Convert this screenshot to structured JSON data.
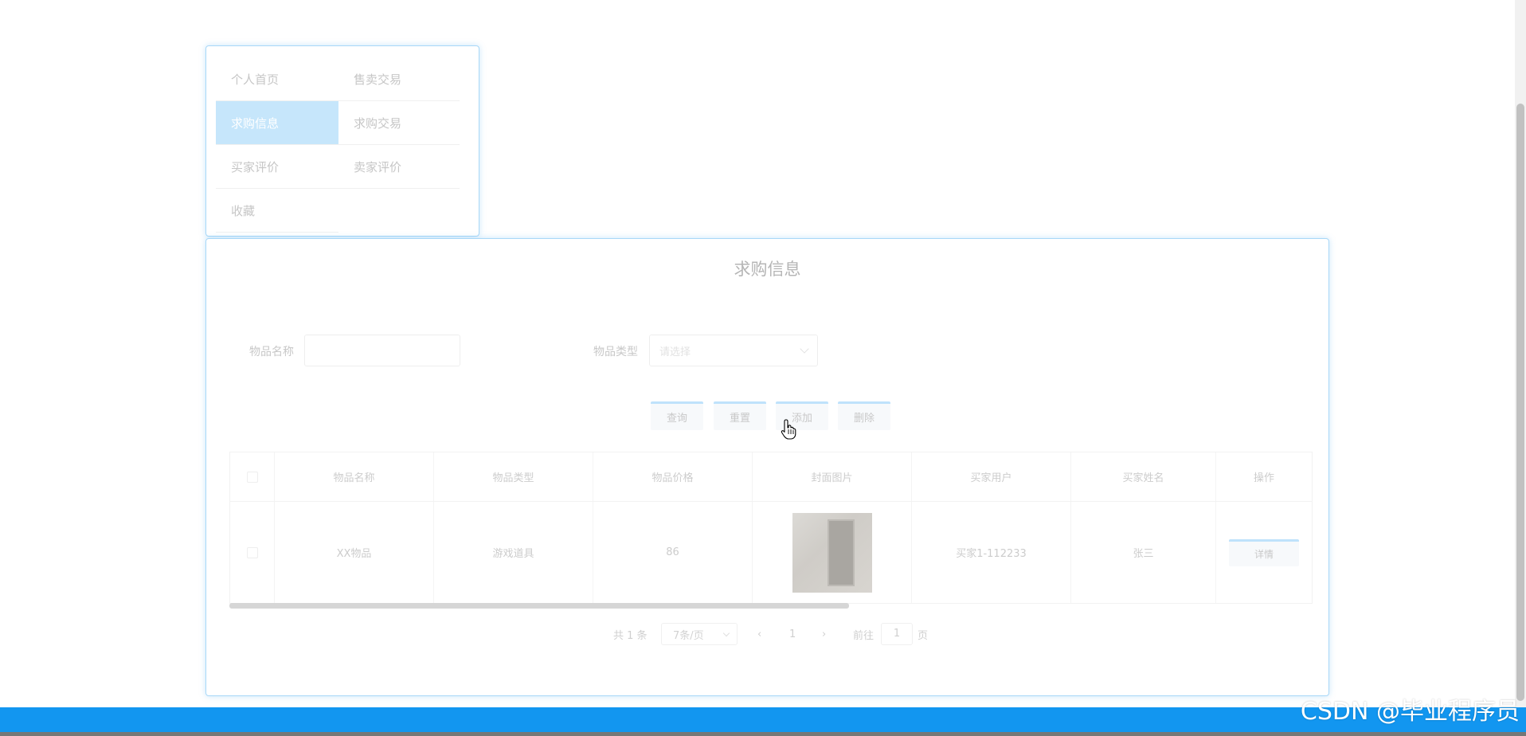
{
  "nav": {
    "items": [
      {
        "label": "个人首页",
        "active": false
      },
      {
        "label": "售卖交易",
        "active": false
      },
      {
        "label": "求购信息",
        "active": true
      },
      {
        "label": "求购交易",
        "active": false
      },
      {
        "label": "买家评价",
        "active": false
      },
      {
        "label": "卖家评价",
        "active": false
      },
      {
        "label": "收藏",
        "active": false
      }
    ]
  },
  "main": {
    "title": "求购信息",
    "search": {
      "name_label": "物品名称",
      "name_value": "",
      "type_label": "物品类型",
      "type_placeholder": "请选择"
    },
    "buttons": {
      "query": "查询",
      "reset": "重置",
      "add": "添加",
      "delete": "删除"
    },
    "table": {
      "columns": [
        "物品名称",
        "物品类型",
        "物品价格",
        "封面图片",
        "买家用户",
        "买家姓名",
        "操作"
      ],
      "rows": [
        {
          "name": "XX物品",
          "type": "游戏道具",
          "price": "86",
          "cover": "door-image",
          "buyer_user": "买家1-112233",
          "buyer_name": "张三",
          "action": "详情"
        }
      ]
    },
    "pager": {
      "total": "共 1 条",
      "page_size": "7条/页",
      "prev": "‹",
      "current": "1",
      "next": "›",
      "goto": "前往",
      "goto_value": "1",
      "page_unit": "页"
    }
  },
  "watermark": "CSDN @毕业程序员",
  "colors": {
    "accent": "#1296f0",
    "active_bg": "#c6e6fb",
    "card_border": "#a8d8f8"
  }
}
